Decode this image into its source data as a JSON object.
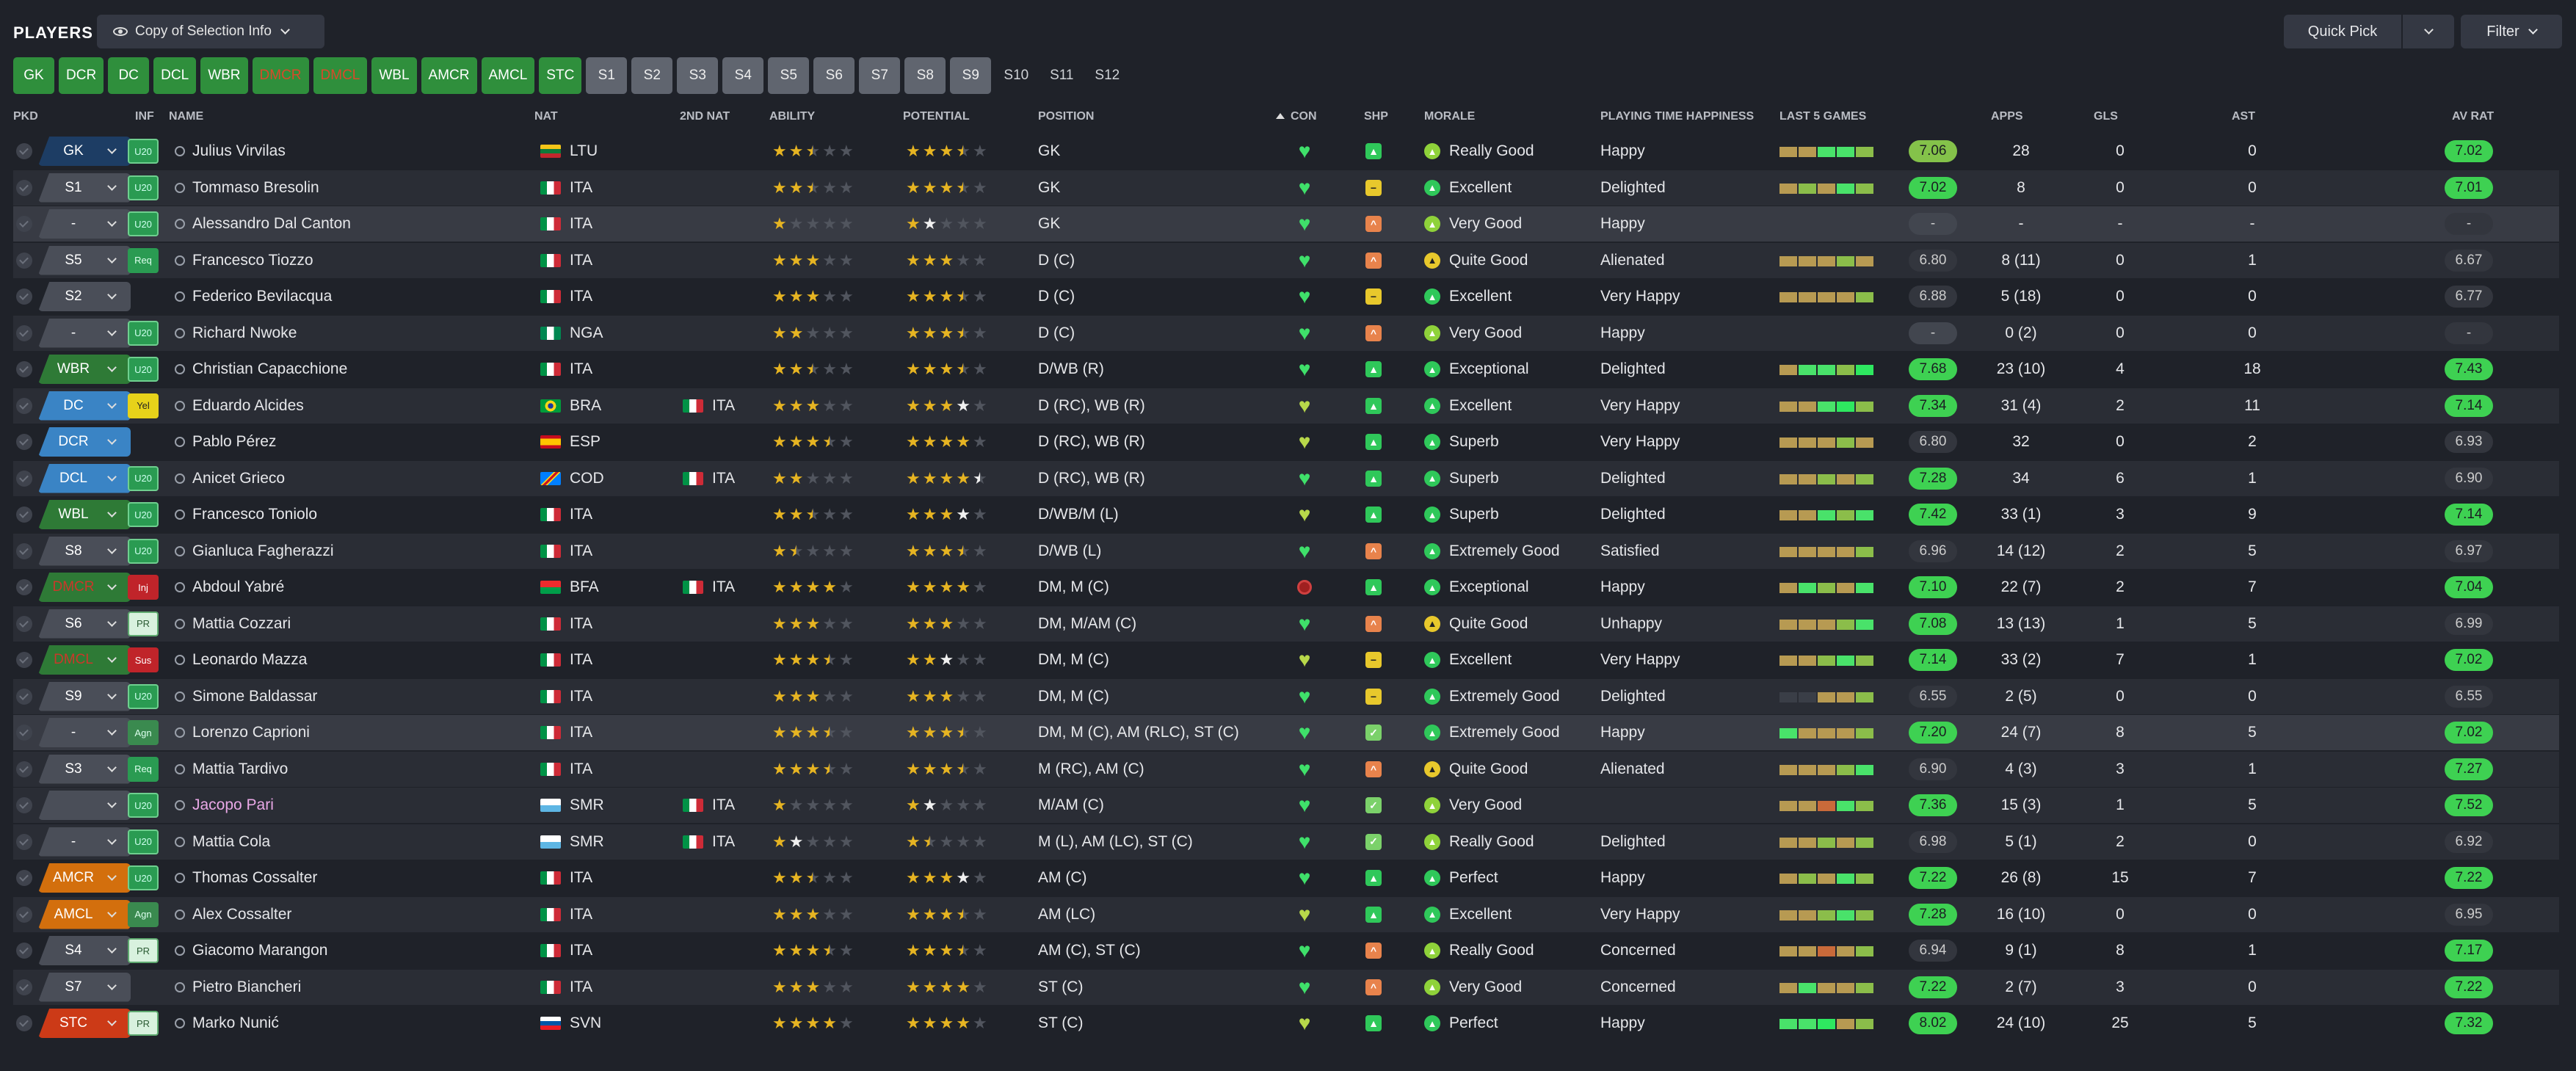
{
  "header": {
    "title": "PLAYERS",
    "view": "Copy of Selection Info",
    "quick_pick": "Quick Pick",
    "filter": "Filter"
  },
  "tactics": [
    {
      "l": "GK",
      "t": "g"
    },
    {
      "l": "DCR",
      "t": "g"
    },
    {
      "l": "DC",
      "t": "g"
    },
    {
      "l": "DCL",
      "t": "g"
    },
    {
      "l": "WBR",
      "t": "g"
    },
    {
      "l": "DMCR",
      "t": "r"
    },
    {
      "l": "DMCL",
      "t": "r"
    },
    {
      "l": "WBL",
      "t": "g"
    },
    {
      "l": "AMCR",
      "t": "g"
    },
    {
      "l": "AMCL",
      "t": "g"
    },
    {
      "l": "STC",
      "t": "g"
    },
    {
      "l": "S1",
      "t": "s"
    },
    {
      "l": "S2",
      "t": "s"
    },
    {
      "l": "S3",
      "t": "s"
    },
    {
      "l": "S4",
      "t": "s"
    },
    {
      "l": "S5",
      "t": "s"
    },
    {
      "l": "S6",
      "t": "s"
    },
    {
      "l": "S7",
      "t": "s"
    },
    {
      "l": "S8",
      "t": "s"
    },
    {
      "l": "S9",
      "t": "s"
    },
    {
      "l": "S10",
      "t": "d"
    },
    {
      "l": "S11",
      "t": "d"
    },
    {
      "l": "S12",
      "t": "d"
    }
  ],
  "columns": {
    "pkd": "PKD",
    "inf": "INF",
    "name": "NAME",
    "nat": "NAT",
    "nat2": "2ND NAT",
    "ability": "ABILITY",
    "potential": "POTENTIAL",
    "position": "POSITION",
    "con": "CON",
    "shp": "SHP",
    "morale": "MORALE",
    "pth": "PLAYING TIME HAPPINESS",
    "l5": "LAST 5 GAMES",
    "apps": "APPS",
    "gls": "GLS",
    "ast": "AST",
    "avrat": "AV RAT"
  },
  "colors": {
    "accent": "#2f8f3c",
    "rating_good": "#3ed152",
    "star": "#e6b422",
    "heart": "#3fe06a"
  },
  "players": [
    {
      "pkd": "GK",
      "pc": "navy",
      "inf": "U20",
      "ic": "u20",
      "name": "Julius Virvilas",
      "nat": "LTU",
      "flag": "ltu",
      "nat2": "",
      "ab": 2.5,
      "po": 3.5,
      "pos": "GK",
      "con": "g",
      "shp": "g",
      "mor": "Really Good",
      "mc": "lg",
      "pth": "Happy",
      "l5": [
        1,
        1,
        3,
        3,
        2
      ],
      "rt": "7.06",
      "rc": "lg",
      "apps": "28",
      "gls": "0",
      "ast": "0",
      "av": "7.02",
      "ac": "g"
    },
    {
      "pkd": "S1",
      "pc": "gray",
      "inf": "U20",
      "ic": "u20",
      "name": "Tommaso Bresolin",
      "nat": "ITA",
      "flag": "ita",
      "nat2": "",
      "ab": 2.5,
      "po": 3.5,
      "pos": "GK",
      "con": "g",
      "shp": "y",
      "mor": "Excellent",
      "mc": "g",
      "pth": "Delighted",
      "l5": [
        1,
        2,
        1,
        3,
        2
      ],
      "rt": "7.02",
      "rc": "g",
      "apps": "8",
      "gls": "0",
      "ast": "0",
      "av": "7.01",
      "ac": "g"
    },
    {
      "pkd": "-",
      "pc": "gray",
      "inf": "U20",
      "ic": "u20",
      "name": "Alessandro Dal Canton",
      "nat": "ITA",
      "flag": "ita",
      "nat2": "",
      "ab": 1,
      "po": 2,
      "pw": true,
      "pos": "GK",
      "con": "g",
      "shp": "o",
      "mor": "Very Good",
      "mc": "lg",
      "pth": "Happy",
      "l5": [],
      "rt": "-",
      "rc": "n",
      "apps": "-",
      "gls": "-",
      "ast": "-",
      "av": "-",
      "ac": "n",
      "hl": true
    },
    {
      "pkd": "S5",
      "pc": "gray",
      "inf": "Req",
      "ic": "req",
      "name": "Francesco Tiozzo",
      "nat": "ITA",
      "flag": "ita",
      "nat2": "",
      "ab": 3,
      "po": 3,
      "pos": "D (C)",
      "con": "g",
      "shp": "o",
      "mor": "Quite Good",
      "mc": "y",
      "pth": "Alienated",
      "l5": [
        1,
        1,
        1,
        2,
        1
      ],
      "rt": "6.80",
      "rc": "d",
      "apps": "8 (11)",
      "gls": "0",
      "ast": "1",
      "av": "6.67",
      "ac": "n"
    },
    {
      "pkd": "S2",
      "pc": "gray",
      "inf": "",
      "ic": "",
      "name": "Federico Bevilacqua",
      "nat": "ITA",
      "flag": "ita",
      "nat2": "",
      "ab": 3,
      "po": 3.5,
      "pos": "D (C)",
      "con": "g",
      "shp": "y",
      "mor": "Excellent",
      "mc": "g",
      "pth": "Very Happy",
      "l5": [
        1,
        1,
        1,
        1,
        2
      ],
      "rt": "6.88",
      "rc": "d",
      "apps": "5 (18)",
      "gls": "0",
      "ast": "0",
      "av": "6.77",
      "ac": "n"
    },
    {
      "pkd": "-",
      "pc": "gray",
      "inf": "U20",
      "ic": "u20",
      "name": "Richard Nwoke",
      "nat": "NGA",
      "flag": "nga",
      "nat2": "",
      "ab": 2,
      "po": 3.5,
      "pos": "D (C)",
      "con": "g",
      "shp": "o",
      "mor": "Very Good",
      "mc": "lg",
      "pth": "Happy",
      "l5": [],
      "rt": "-",
      "rc": "n",
      "apps": "0 (2)",
      "gls": "0",
      "ast": "0",
      "av": "-",
      "ac": "n",
      "alt": true
    },
    {
      "pkd": "WBR",
      "pc": "green",
      "inf": "U20",
      "ic": "u20",
      "name": "Christian Capacchione",
      "nat": "ITA",
      "flag": "ita",
      "nat2": "",
      "ab": 2.5,
      "po": 3.5,
      "pos": "D/WB (R)",
      "con": "g",
      "shp": "g",
      "mor": "Exceptional",
      "mc": "g",
      "pth": "Delighted",
      "l5": [
        1,
        3,
        3,
        2,
        4
      ],
      "rt": "7.68",
      "rc": "g",
      "apps": "23 (10)",
      "gls": "4",
      "ast": "18",
      "av": "7.43",
      "ac": "g"
    },
    {
      "pkd": "DC",
      "pc": "blue",
      "inf": "Yel",
      "ic": "yel",
      "name": "Eduardo Alcides",
      "nat": "BRA",
      "flag": "bra",
      "nat2": "ITA",
      "ab": 3,
      "po": 4,
      "pw": true,
      "pos": "D (RC), WB (R)",
      "con": "y",
      "shp": "g",
      "mor": "Excellent",
      "mc": "g",
      "pth": "Very Happy",
      "l5": [
        1,
        1,
        3,
        4,
        2
      ],
      "rt": "7.34",
      "rc": "g",
      "apps": "31 (4)",
      "gls": "2",
      "ast": "11",
      "av": "7.14",
      "ac": "g"
    },
    {
      "pkd": "DCR",
      "pc": "blue",
      "inf": "",
      "ic": "",
      "name": "Pablo Pérez",
      "nat": "ESP",
      "flag": "esp",
      "nat2": "",
      "ab": 3.5,
      "po": 4,
      "pos": "D (RC), WB (R)",
      "con": "y",
      "shp": "g",
      "mor": "Superb",
      "mc": "g",
      "pth": "Very Happy",
      "l5": [
        1,
        1,
        1,
        2,
        1
      ],
      "rt": "6.80",
      "rc": "d",
      "apps": "32",
      "gls": "0",
      "ast": "2",
      "av": "6.93",
      "ac": "n"
    },
    {
      "pkd": "DCL",
      "pc": "blue",
      "inf": "U20",
      "ic": "u20",
      "name": "Anicet Griеco",
      "nat": "COD",
      "flag": "cod",
      "nat2": "ITA",
      "ab": 2,
      "po": 4.5,
      "pw": true,
      "pos": "D (RC), WB (R)",
      "con": "g",
      "shp": "g",
      "mor": "Superb",
      "mc": "g",
      "pth": "Delighted",
      "l5": [
        1,
        1,
        2,
        1,
        2
      ],
      "rt": "7.28",
      "rc": "g",
      "apps": "34",
      "gls": "6",
      "ast": "1",
      "av": "6.90",
      "ac": "n"
    },
    {
      "pkd": "WBL",
      "pc": "green",
      "inf": "U20",
      "ic": "u20",
      "name": "Francesco Toniolo",
      "nat": "ITA",
      "flag": "ita",
      "nat2": "",
      "ab": 2.5,
      "po": 4,
      "pw": true,
      "pos": "D/WB/M (L)",
      "con": "y",
      "shp": "g",
      "mor": "Superb",
      "mc": "g",
      "pth": "Delighted",
      "l5": [
        1,
        1,
        3,
        2,
        3
      ],
      "rt": "7.42",
      "rc": "g",
      "apps": "33 (1)",
      "gls": "3",
      "ast": "9",
      "av": "7.14",
      "ac": "g"
    },
    {
      "pkd": "S8",
      "pc": "gray",
      "inf": "U20",
      "ic": "u20",
      "name": "Gianluca Fagherazzi",
      "nat": "ITA",
      "flag": "ita",
      "nat2": "",
      "ab": 1.5,
      "po": 3.5,
      "pos": "D/WB (L)",
      "con": "g",
      "shp": "o",
      "mor": "Extremely Good",
      "mc": "g",
      "pth": "Satisfied",
      "l5": [
        1,
        1,
        1,
        1,
        2
      ],
      "rt": "6.96",
      "rc": "d",
      "apps": "14 (12)",
      "gls": "2",
      "ast": "5",
      "av": "6.97",
      "ac": "n"
    },
    {
      "pkd": "DMCR",
      "pc": "green",
      "warn": true,
      "inf": "Inj",
      "ic": "inj",
      "name": "Abdoul Yabré",
      "nat": "BFA",
      "flag": "bfa",
      "nat2": "ITA",
      "ab": 4,
      "po": 4,
      "pos": "DM, M (C)",
      "con": "r",
      "shp": "g",
      "mor": "Exceptional",
      "mc": "g",
      "pth": "Happy",
      "l5": [
        1,
        3,
        2,
        1,
        3
      ],
      "rt": "7.10",
      "rc": "g",
      "apps": "22 (7)",
      "gls": "2",
      "ast": "7",
      "av": "7.04",
      "ac": "g"
    },
    {
      "pkd": "S6",
      "pc": "gray",
      "inf": "PR",
      "ic": "pr",
      "name": "Mattia Cozzari",
      "nat": "ITA",
      "flag": "ita",
      "nat2": "",
      "ab": 3,
      "po": 3,
      "pos": "DM, M/AM (C)",
      "con": "g",
      "shp": "o",
      "mor": "Quite Good",
      "mc": "y",
      "pth": "Unhappy",
      "l5": [
        1,
        1,
        1,
        2,
        3
      ],
      "rt": "7.08",
      "rc": "g",
      "apps": "13 (13)",
      "gls": "1",
      "ast": "5",
      "av": "6.99",
      "ac": "n"
    },
    {
      "pkd": "DMCL",
      "pc": "green",
      "warn": true,
      "inf": "Sus",
      "ic": "sus",
      "name": "Leonardo Mazza",
      "nat": "ITA",
      "flag": "ita",
      "nat2": "",
      "ab": 3.5,
      "po": 3,
      "pw": true,
      "pos": "DM, M (C)",
      "con": "y",
      "shp": "y",
      "mor": "Excellent",
      "mc": "g",
      "pth": "Very Happy",
      "l5": [
        1,
        1,
        2,
        3,
        2
      ],
      "rt": "7.14",
      "rc": "g",
      "apps": "33 (2)",
      "gls": "7",
      "ast": "1",
      "av": "7.02",
      "ac": "g"
    },
    {
      "pkd": "S9",
      "pc": "gray",
      "inf": "U20",
      "ic": "u20",
      "name": "Simone Baldassar",
      "nat": "ITA",
      "flag": "ita",
      "nat2": "",
      "ab": 3,
      "po": 3,
      "pos": "DM, M (C)",
      "con": "g",
      "shp": "y",
      "mor": "Extremely Good",
      "mc": "g",
      "pth": "Delighted",
      "l5": [
        0,
        0,
        1,
        1,
        2
      ],
      "rt": "6.55",
      "rc": "d",
      "apps": "2 (5)",
      "gls": "0",
      "ast": "0",
      "av": "6.55",
      "ac": "n"
    },
    {
      "pkd": "-",
      "pc": "gray",
      "inf": "Agn",
      "ic": "agn",
      "name": "Lorenzo Caprioni",
      "nat": "ITA",
      "flag": "ita",
      "nat2": "",
      "ab": 3.5,
      "po": 3.5,
      "pos": "DM, M (C), AM (RLC), ST (C)",
      "con": "g",
      "shp": "lg",
      "mor": "Extremely Good",
      "mc": "g",
      "pth": "Happy",
      "l5": [
        3,
        1,
        1,
        1,
        2
      ],
      "rt": "7.20",
      "rc": "g",
      "apps": "24 (7)",
      "gls": "8",
      "ast": "5",
      "av": "7.02",
      "ac": "g",
      "hl": true
    },
    {
      "pkd": "S3",
      "pc": "gray",
      "inf": "Req",
      "ic": "req",
      "name": "Mattia Tardivo",
      "nat": "ITA",
      "flag": "ita",
      "nat2": "",
      "ab": 3.5,
      "po": 3.5,
      "pos": "M (RC), AM (C)",
      "con": "g",
      "shp": "o",
      "mor": "Quite Good",
      "mc": "y",
      "pth": "Alienated",
      "l5": [
        1,
        1,
        1,
        2,
        3
      ],
      "rt": "6.90",
      "rc": "d",
      "apps": "4 (3)",
      "gls": "3",
      "ast": "1",
      "av": "7.27",
      "ac": "g"
    },
    {
      "pkd": "",
      "pc": "gray",
      "inf": "U20",
      "ic": "u20",
      "name": "Jacopo Pari",
      "pink": true,
      "nat": "SMR",
      "flag": "smr",
      "nat2": "ITA",
      "ab": 1,
      "po": 2,
      "pw": true,
      "pos": "M/AM (C)",
      "con": "g",
      "shp": "lg",
      "mor": "Very Good",
      "mc": "lg",
      "pth": "",
      "l5": [
        1,
        1,
        5,
        3,
        2
      ],
      "rt": "7.36",
      "rc": "g",
      "apps": "15 (3)",
      "gls": "1",
      "ast": "5",
      "av": "7.52",
      "ac": "g",
      "alt": true
    },
    {
      "pkd": "-",
      "pc": "gray",
      "inf": "U20",
      "ic": "u20",
      "name": "Mattia Cola",
      "nat": "SMR",
      "flag": "smr",
      "nat2": "ITA",
      "ab": 2,
      "aw": true,
      "po": 1.5,
      "pos": "M (L), AM (LC), ST (C)",
      "con": "g",
      "shp": "lg",
      "mor": "Really Good",
      "mc": "lg",
      "pth": "Delighted",
      "l5": [
        1,
        1,
        2,
        1,
        2
      ],
      "rt": "6.98",
      "rc": "d",
      "apps": "5 (1)",
      "gls": "2",
      "ast": "0",
      "av": "6.92",
      "ac": "n"
    },
    {
      "pkd": "AMCR",
      "pc": "orange",
      "inf": "U20",
      "ic": "u20",
      "name": "Thomas Cossalter",
      "nat": "ITA",
      "flag": "ita",
      "nat2": "",
      "ab": 2.5,
      "po": 4,
      "pw": true,
      "pos": "AM (C)",
      "con": "g",
      "shp": "g",
      "mor": "Perfect",
      "mc": "g",
      "pth": "Happy",
      "l5": [
        1,
        2,
        1,
        3,
        2
      ],
      "rt": "7.22",
      "rc": "g",
      "apps": "26 (8)",
      "gls": "15",
      "ast": "7",
      "av": "7.22",
      "ac": "g"
    },
    {
      "pkd": "AMCL",
      "pc": "orange",
      "inf": "Agn",
      "ic": "agn",
      "name": "Alex Cossalter",
      "nat": "ITA",
      "flag": "ita",
      "nat2": "",
      "ab": 3,
      "po": 3.5,
      "pos": "AM (LC)",
      "con": "y",
      "shp": "g",
      "mor": "Excellent",
      "mc": "g",
      "pth": "Very Happy",
      "l5": [
        1,
        1,
        2,
        3,
        2
      ],
      "rt": "7.28",
      "rc": "g",
      "apps": "16 (10)",
      "gls": "0",
      "ast": "0",
      "av": "6.95",
      "ac": "n"
    },
    {
      "pkd": "S4",
      "pc": "gray",
      "inf": "PR",
      "ic": "pr",
      "name": "Giacomo Marangon",
      "nat": "ITA",
      "flag": "ita",
      "nat2": "",
      "ab": 3.5,
      "po": 3.5,
      "pos": "AM (C), ST (C)",
      "con": "g",
      "shp": "o",
      "mor": "Really Good",
      "mc": "lg",
      "pth": "Concerned",
      "l5": [
        1,
        1,
        5,
        1,
        2
      ],
      "rt": "6.94",
      "rc": "d",
      "apps": "9 (1)",
      "gls": "8",
      "ast": "1",
      "av": "7.17",
      "ac": "g"
    },
    {
      "pkd": "S7",
      "pc": "gray",
      "inf": "",
      "ic": "",
      "name": "Pietro Biancheri",
      "nat": "ITA",
      "flag": "ita",
      "nat2": "",
      "ab": 3,
      "po": 4,
      "pos": "ST (C)",
      "con": "g",
      "shp": "o",
      "mor": "Very Good",
      "mc": "lg",
      "pth": "Concerned",
      "l5": [
        1,
        3,
        1,
        1,
        2
      ],
      "rt": "7.22",
      "rc": "g",
      "apps": "2 (7)",
      "gls": "3",
      "ast": "0",
      "av": "7.22",
      "ac": "g"
    },
    {
      "pkd": "STC",
      "pc": "red",
      "inf": "PR",
      "ic": "pr",
      "name": "Marko Nunić",
      "nat": "SVN",
      "flag": "svn",
      "nat2": "",
      "ab": 4,
      "po": 4,
      "pos": "ST (C)",
      "con": "y",
      "shp": "g",
      "mor": "Perfect",
      "mc": "g",
      "pth": "Happy",
      "l5": [
        3,
        3,
        4,
        1,
        2
      ],
      "rt": "8.02",
      "rc": "g",
      "apps": "24 (10)",
      "gls": "25",
      "ast": "5",
      "av": "7.32",
      "ac": "g"
    }
  ]
}
